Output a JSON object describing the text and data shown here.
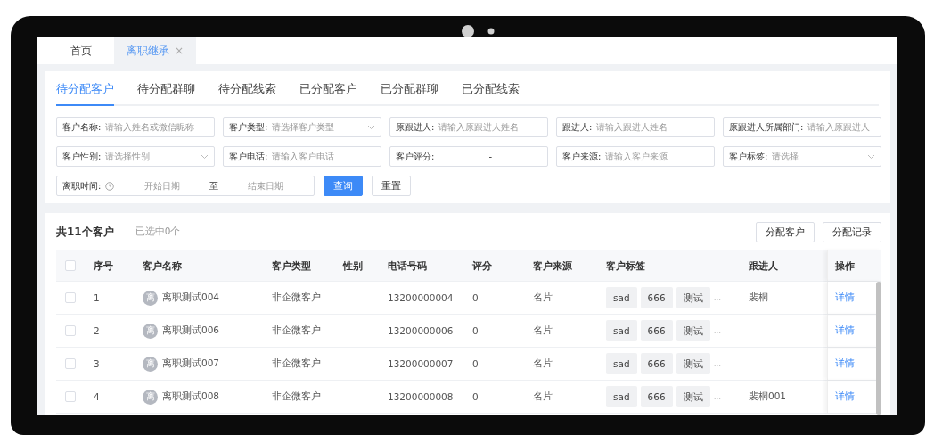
{
  "page_tabs": [
    {
      "label": "首页",
      "selected": false
    },
    {
      "label": "离职继承",
      "selected": true,
      "close": "×"
    }
  ],
  "sub_tabs": [
    {
      "label": "待分配客户",
      "selected": true
    },
    {
      "label": "待分配群聊",
      "selected": false
    },
    {
      "label": "待分配线索",
      "selected": false
    },
    {
      "label": "已分配客户",
      "selected": false
    },
    {
      "label": "已分配群聊",
      "selected": false
    },
    {
      "label": "已分配线索",
      "selected": false
    }
  ],
  "filters": [
    {
      "kind": "text",
      "label": "客户名称:",
      "placeholder": "请输入姓名或微信昵称"
    },
    {
      "kind": "select",
      "label": "客户类型:",
      "placeholder": "请选择客户类型"
    },
    {
      "kind": "text",
      "label": "原跟进人:",
      "placeholder": "请输入原跟进人姓名"
    },
    {
      "kind": "text",
      "label": "跟进人:",
      "placeholder": "请输入跟进人姓名"
    },
    {
      "kind": "text",
      "label": "原跟进人所属部门:",
      "placeholder": "请输入原跟进人"
    },
    {
      "kind": "select",
      "label": "客户性别:",
      "placeholder": "请选择性别"
    },
    {
      "kind": "text",
      "label": "客户电话:",
      "placeholder": "请输入客户电话"
    },
    {
      "kind": "range",
      "label": "客户评分:",
      "separator": "-"
    },
    {
      "kind": "text",
      "label": "客户来源:",
      "placeholder": "请输入客户来源"
    },
    {
      "kind": "select",
      "label": "客户标签:",
      "placeholder": "请选择"
    }
  ],
  "date_filter": {
    "label": "离职时间:",
    "start_placeholder": "开始日期",
    "separator": "至",
    "end_placeholder": "结束日期"
  },
  "filter_buttons": [
    {
      "label": "查询",
      "kind": "primary"
    },
    {
      "label": "重置",
      "kind": "default"
    }
  ],
  "summary": {
    "total": "共11个客户",
    "selected_count": "已选中0个"
  },
  "actions": [
    "分配客户",
    "分配记录"
  ],
  "table": {
    "columns": [
      "序号",
      "客户名称",
      "客户类型",
      "性别",
      "电话号码",
      "评分",
      "客户来源",
      "客户标签",
      "跟进人",
      "操作"
    ],
    "all_checked": false,
    "rows": [
      {
        "checked": false,
        "index": "1",
        "avatar": "离",
        "name": "离职测试004",
        "type": "非企微客户",
        "gender": "-",
        "phone": "13200000004",
        "score": "0",
        "source": "名片",
        "tags": [
          "sad",
          "666",
          "测试"
        ],
        "more": "...",
        "owner": "裴桐",
        "action": "详情"
      },
      {
        "checked": false,
        "index": "2",
        "avatar": "离",
        "name": "离职测试006",
        "type": "非企微客户",
        "gender": "-",
        "phone": "13200000006",
        "score": "0",
        "source": "名片",
        "tags": [
          "sad",
          "666",
          "测试"
        ],
        "more": "...",
        "owner": "-",
        "action": "详情"
      },
      {
        "checked": false,
        "index": "3",
        "avatar": "离",
        "name": "离职测试007",
        "type": "非企微客户",
        "gender": "-",
        "phone": "13200000007",
        "score": "0",
        "source": "名片",
        "tags": [
          "sad",
          "666",
          "测试"
        ],
        "more": "...",
        "owner": "-",
        "action": "详情"
      },
      {
        "checked": false,
        "index": "4",
        "avatar": "离",
        "name": "离职测试008",
        "type": "非企微客户",
        "gender": "-",
        "phone": "13200000008",
        "score": "0",
        "source": "名片",
        "tags": [
          "sad",
          "666",
          "测试"
        ],
        "more": "...",
        "owner": "裴桐001",
        "action": "详情"
      }
    ]
  }
}
